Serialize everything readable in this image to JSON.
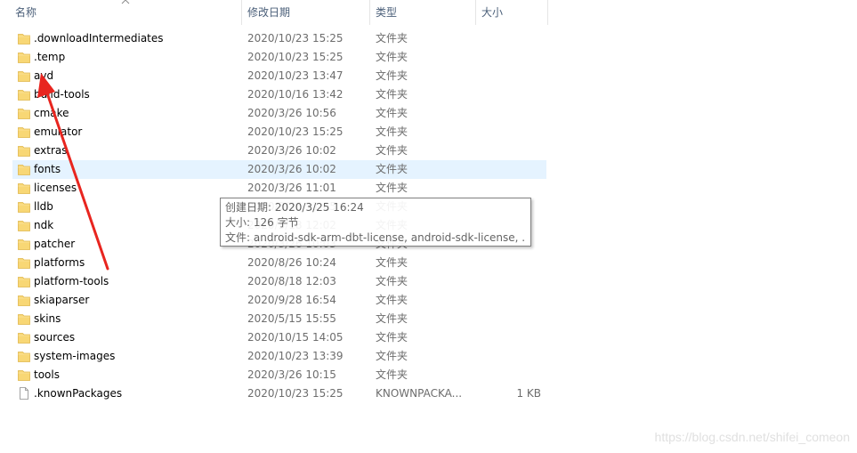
{
  "header": {
    "name_label": "名称",
    "date_label": "修改日期",
    "type_label": "类型",
    "size_label": "大小"
  },
  "files": [
    {
      "name": ".downloadIntermediates",
      "date": "2020/10/23 15:25",
      "type": "文件夹",
      "size": "",
      "kind": "folder"
    },
    {
      "name": ".temp",
      "date": "2020/10/23 15:25",
      "type": "文件夹",
      "size": "",
      "kind": "folder"
    },
    {
      "name": "avd",
      "date": "2020/10/23 13:47",
      "type": "文件夹",
      "size": "",
      "kind": "folder"
    },
    {
      "name": "build-tools",
      "date": "2020/10/16 13:42",
      "type": "文件夹",
      "size": "",
      "kind": "folder"
    },
    {
      "name": "cmake",
      "date": "2020/3/26 10:56",
      "type": "文件夹",
      "size": "",
      "kind": "folder"
    },
    {
      "name": "emulator",
      "date": "2020/10/23 15:25",
      "type": "文件夹",
      "size": "",
      "kind": "folder"
    },
    {
      "name": "extras",
      "date": "2020/3/26 10:02",
      "type": "文件夹",
      "size": "",
      "kind": "folder"
    },
    {
      "name": "fonts",
      "date": "2020/3/26 10:02",
      "type": "文件夹",
      "size": "",
      "kind": "folder",
      "hover": true
    },
    {
      "name": "licenses",
      "date": "2020/3/26 11:01",
      "type": "文件夹",
      "size": "",
      "kind": "folder"
    },
    {
      "name": "lldb",
      "date": "2020/3/26 11:05",
      "type": "文件夹",
      "size": "",
      "kind": "folder"
    },
    {
      "name": "ndk",
      "date": "2020/3/18 12:02",
      "type": "文件夹",
      "size": "",
      "kind": "folder"
    },
    {
      "name": "patcher",
      "date": "2020/3/26 10:03",
      "type": "文件夹",
      "size": "",
      "kind": "folder"
    },
    {
      "name": "platforms",
      "date": "2020/8/26 10:24",
      "type": "文件夹",
      "size": "",
      "kind": "folder"
    },
    {
      "name": "platform-tools",
      "date": "2020/8/18 12:03",
      "type": "文件夹",
      "size": "",
      "kind": "folder"
    },
    {
      "name": "skiaparser",
      "date": "2020/9/28 16:54",
      "type": "文件夹",
      "size": "",
      "kind": "folder"
    },
    {
      "name": "skins",
      "date": "2020/5/15 15:55",
      "type": "文件夹",
      "size": "",
      "kind": "folder"
    },
    {
      "name": "sources",
      "date": "2020/10/15 14:05",
      "type": "文件夹",
      "size": "",
      "kind": "folder"
    },
    {
      "name": "system-images",
      "date": "2020/10/23 13:39",
      "type": "文件夹",
      "size": "",
      "kind": "folder"
    },
    {
      "name": "tools",
      "date": "2020/3/26 10:15",
      "type": "文件夹",
      "size": "",
      "kind": "folder"
    },
    {
      "name": ".knownPackages",
      "date": "2020/10/23 15:25",
      "type": "KNOWNPACKA...",
      "size": "1 KB",
      "kind": "file"
    }
  ],
  "tooltip": {
    "created": "创建日期: 2020/3/25 16:24",
    "size": "大小: 126 字节",
    "files": "文件: android-sdk-arm-dbt-license, android-sdk-license, ..."
  },
  "watermark": "https://blog.csdn.net/shifei_comeon",
  "colors": {
    "header_text": "#4c607a",
    "hover_bg": "#e5f3ff",
    "folder": "#f8d775",
    "arrow": "#e8251f"
  }
}
